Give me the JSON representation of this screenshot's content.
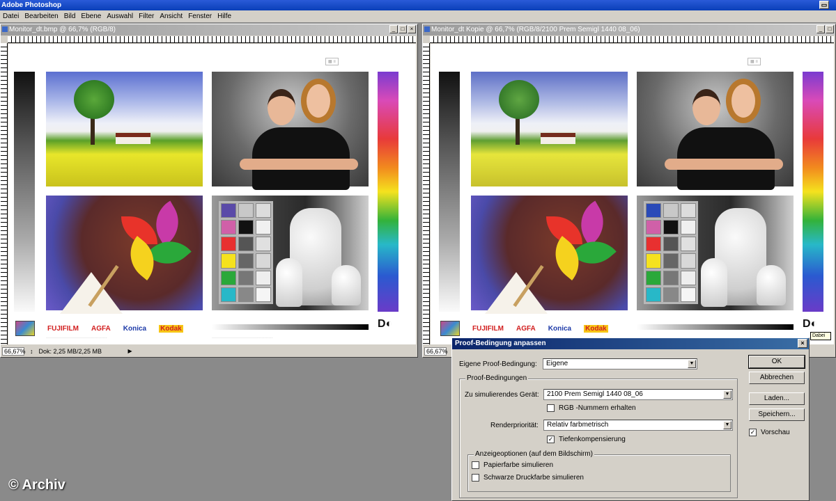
{
  "app": {
    "title": "Adobe Photoshop"
  },
  "menu": [
    "Datei",
    "Bearbeiten",
    "Bild",
    "Ebene",
    "Auswahl",
    "Filter",
    "Ansicht",
    "Fenster",
    "Hilfe"
  ],
  "windows": [
    {
      "title": "Monitor_dt.bmp @ 66,7% (RGB/8)",
      "zoom": "66,67%",
      "doc": "Dok: 2,25 MB/2,25 MB"
    },
    {
      "title": "Monitor_dt Kopie @ 66,7% (RGB/8/2100 Prem Semigl 1440 08_06)",
      "zoom": "66,67%"
    }
  ],
  "chart_brands": {
    "fuji": "FUJIFILM",
    "agfa": "AGFA",
    "konica": "Konica",
    "kodak": "Kodak"
  },
  "dialog": {
    "title": "Proof-Bedingung anpassen",
    "custom_label": "Eigene Proof-Bedingung:",
    "custom_value": "Eigene",
    "group_label": "Proof-Bedingungen",
    "device_label": "Zu simulierendes Gerät:",
    "device_value": "2100 Prem Semigl 1440 08_06",
    "rgb_label": "RGB -Nummern erhalten",
    "intent_label": "Renderpriorität:",
    "intent_value": "Relativ farbmetrisch",
    "bpc_label": "Tiefenkompensierung",
    "display_group_label": "Anzeigeoptionen (auf dem Bildschirm)",
    "paper_label": "Papierfarbe simulieren",
    "ink_label": "Schwarze Druckfarbe simulieren",
    "ok": "OK",
    "cancel": "Abbrechen",
    "load": "Laden...",
    "save": "Speichern...",
    "preview": "Vorschau"
  },
  "tooltip": "Dabei",
  "watermark": "© Archiv",
  "colors": {
    "dialog_title": "#0a246a",
    "app_title": "#2a5bd8",
    "face": "#d4d0c8"
  }
}
